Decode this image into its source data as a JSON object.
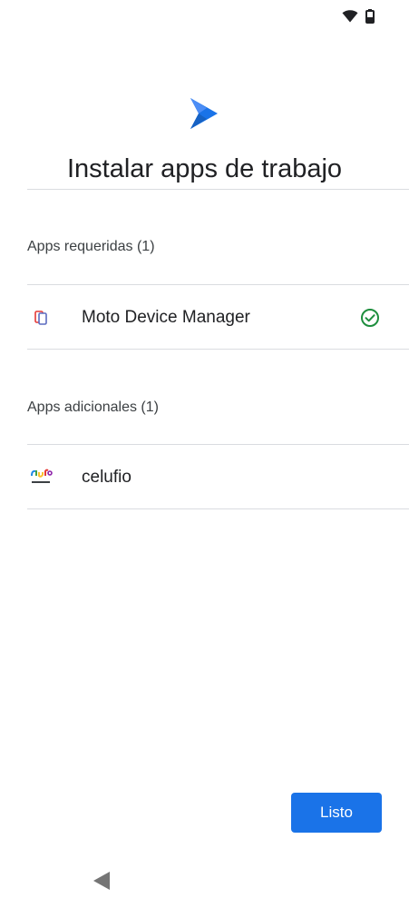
{
  "status_bar": {
    "icons": [
      "wifi-icon",
      "battery-icon"
    ]
  },
  "header": {
    "logo_icon": "play-store-logo",
    "title": "Instalar apps de trabajo"
  },
  "required_section": {
    "header": "Apps requeridas (1)",
    "apps": [
      {
        "name": "Moto Device Manager",
        "icon": "moto-device-manager-icon",
        "status_icon": "check-circle-icon"
      }
    ]
  },
  "additional_section": {
    "header": "Apps adicionales (1)",
    "apps": [
      {
        "name": "celufio",
        "icon": "celufio-icon"
      }
    ]
  },
  "footer": {
    "done_label": "Listo"
  },
  "navigation": {
    "back_icon": "back-triangle-icon"
  },
  "colors": {
    "primary": "#1a73e8",
    "check_green": "#1e8e3e",
    "divider": "#dadce0"
  }
}
